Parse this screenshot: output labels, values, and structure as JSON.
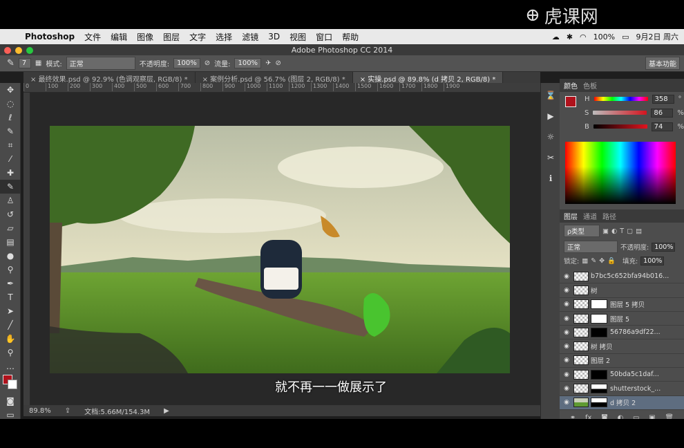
{
  "menubar": {
    "app_name": "Photoshop",
    "items": [
      "文件",
      "编辑",
      "图像",
      "图层",
      "文字",
      "选择",
      "滤镜",
      "3D",
      "视图",
      "窗口",
      "帮助"
    ],
    "battery": "100%",
    "date": "9月2日 周六"
  },
  "watermark": {
    "text": "虎课网"
  },
  "window": {
    "title": "Adobe Photoshop CC 2014"
  },
  "options_bar": {
    "brush_size": "7",
    "mode_label": "模式:",
    "mode_value": "正常",
    "opacity_label": "不透明度:",
    "opacity_value": "100%",
    "flow_label": "流量:",
    "flow_value": "100%",
    "workspace": "基本功能"
  },
  "tabs": [
    {
      "label": "最终效果.psd @ 92.9% (色调观察层, RGB/8) *"
    },
    {
      "label": "案例分析.psd @ 56.7% (图层 2, RGB/8) *"
    },
    {
      "label": "实操.psd @ 89.8% (d 拷贝 2, RGB/8) *"
    }
  ],
  "ruler_ticks": [
    "0",
    "100",
    "200",
    "300",
    "400",
    "500",
    "600",
    "700",
    "800",
    "900",
    "1000",
    "1100",
    "1200",
    "1300",
    "1400",
    "1500",
    "1600",
    "1700",
    "1800",
    "1900"
  ],
  "subtitle": "就不再一一做展示了",
  "status": {
    "zoom": "89.8%",
    "doc_info": "文档:5.66M/154.3M"
  },
  "color_panel": {
    "tabs": [
      "颜色",
      "色板"
    ],
    "h": {
      "label": "H",
      "value": "358",
      "unit": "°"
    },
    "s": {
      "label": "S",
      "value": "86",
      "unit": "%"
    },
    "b": {
      "label": "B",
      "value": "74",
      "unit": "%"
    },
    "foreground": "#b0121c"
  },
  "layers_panel": {
    "tabs": [
      "图层",
      "通道",
      "路径"
    ],
    "filter": "ρ类型",
    "blend_mode": "正常",
    "opacity_label": "不透明度:",
    "opacity_value": "100%",
    "lock_label": "锁定:",
    "fill_label": "填充:",
    "fill_value": "100%",
    "layers": [
      {
        "name": "b7bc5c652bfa94b016...",
        "selected": false,
        "mask": false
      },
      {
        "name": "树",
        "selected": false,
        "mask": false
      },
      {
        "name": "图层 5 拷贝",
        "selected": false,
        "mask": true
      },
      {
        "name": "图层 5",
        "selected": false,
        "mask": true
      },
      {
        "name": "56786a9df22...",
        "selected": false,
        "mask": true
      },
      {
        "name": "树 拷贝",
        "selected": false,
        "mask": false
      },
      {
        "name": "图层 2",
        "selected": false,
        "mask": false
      },
      {
        "name": "50bda5c1daf...",
        "selected": false,
        "mask": true
      },
      {
        "name": "shutterstock_...",
        "selected": false,
        "mask": true
      },
      {
        "name": "d 拷贝 2",
        "selected": true,
        "mask": true
      }
    ]
  }
}
